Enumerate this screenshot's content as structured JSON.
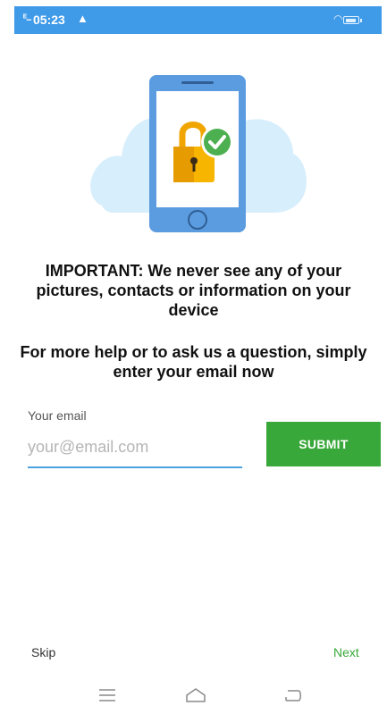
{
  "status_bar": {
    "signal": "ᴱ...",
    "time": "05:23",
    "alert_icon": "warning-icon",
    "battery_level": 0.7
  },
  "illustration": {
    "icons": [
      "phone-icon",
      "lock-icon",
      "checkmark-icon"
    ]
  },
  "headline": "IMPORTANT: We never see any of your pictures, contacts or information on your device",
  "subhead": "For more help or to ask us a question, simply enter your email now",
  "form": {
    "email_label": "Your email",
    "email_placeholder": "your@email.com",
    "email_value": "",
    "submit_label": "SUBMIT"
  },
  "footer": {
    "skip_label": "Skip",
    "next_label": "Next"
  },
  "nav_icons": [
    "menu-icon",
    "home-icon",
    "back-icon"
  ],
  "colors": {
    "status_bar": "#3f9ae8",
    "accent": "#39a83a",
    "input_underline": "#4aa3df"
  }
}
